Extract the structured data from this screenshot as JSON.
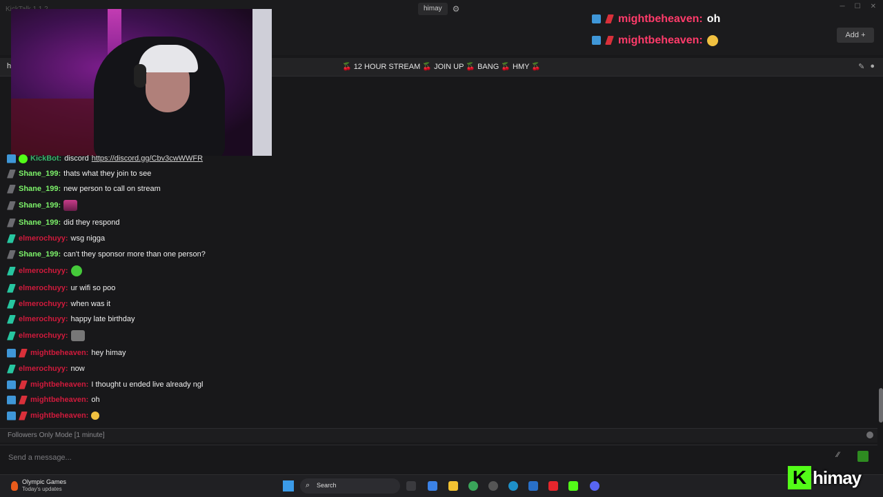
{
  "app": {
    "title": "KickTalk 1.1.2"
  },
  "header": {
    "tab_label": "himay",
    "add_label": "Add"
  },
  "overlay": [
    {
      "user": "mightbeheaven:",
      "text": "oh"
    },
    {
      "user": "mightbeheaven:",
      "text": ""
    }
  ],
  "stream": {
    "title": "🍒 12 HOUR STREAM 🍒 JOIN UP 🍒 BANG 🍒 HMY 🍒",
    "left_edge": "h"
  },
  "chat": [
    {
      "user": "KickBot:",
      "text": "discord",
      "link": "https://discord.gg/Cbv3cwWWFR"
    },
    {
      "user": "Shane_199:",
      "text": "thats what they join to see"
    },
    {
      "user": "Shane_199:",
      "text": "new person to call on stream"
    },
    {
      "user": "Shane_199:",
      "text": ""
    },
    {
      "user": "Shane_199:",
      "text": "did they respond"
    },
    {
      "user": "elmerochuyy:",
      "text": "wsg nigga"
    },
    {
      "user": "Shane_199:",
      "text": "can't they sponsor more than one person?"
    },
    {
      "user": "elmerochuyy:",
      "text": ""
    },
    {
      "user": "elmerochuyy:",
      "text": "ur wifi so poo"
    },
    {
      "user": "elmerochuyy:",
      "text": "when was it"
    },
    {
      "user": "elmerochuyy:",
      "text": "happy late birthday"
    },
    {
      "user": "elmerochuyy:",
      "text": ""
    },
    {
      "user": "mightbeheaven:",
      "text": "hey himay"
    },
    {
      "user": "elmerochuyy:",
      "text": "now"
    },
    {
      "user": "mightbeheaven:",
      "text": "I thought u ended live already ngl"
    },
    {
      "user": "mightbeheaven:",
      "text": "oh"
    },
    {
      "user": "mightbeheaven:",
      "text": ""
    }
  ],
  "footer": {
    "followers_mode": "Followers Only Mode [1 minute]",
    "message_placeholder": "Send a message..."
  },
  "taskbar": {
    "weather_title": "Olympic Games",
    "weather_sub": "Today's updates",
    "search_label": "Search"
  },
  "brand": {
    "k": "K",
    "name": "himay"
  },
  "colors": {
    "kick_green": "#53fc18",
    "user_green": "#7df36a",
    "user_red": "#d01a3c",
    "bg": "#18181a"
  }
}
